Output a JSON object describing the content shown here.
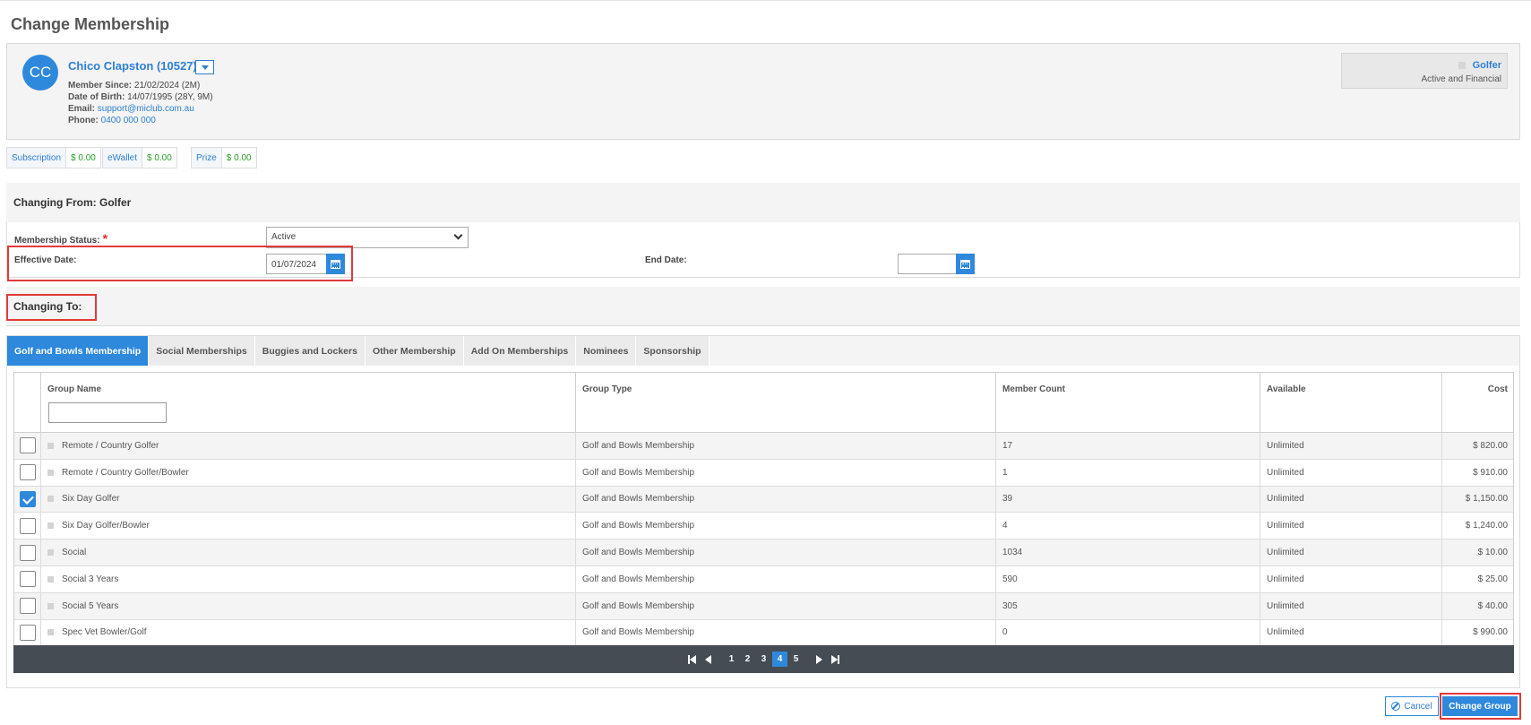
{
  "page": {
    "title": "Change Membership"
  },
  "member": {
    "initials": "CC",
    "name": "Chico Clapston (10527)",
    "member_since_label": "Member Since:",
    "member_since": "21/02/2024 (2M)",
    "dob_label": "Date of Birth:",
    "dob": "14/07/1995 (28Y, 9M)",
    "email_label": "Email:",
    "email": "support@miclub.com.au",
    "phone_label": "Phone:",
    "phone": "0400 000 000",
    "membership_type": "Golfer",
    "membership_status": "Active and Financial"
  },
  "balances": [
    {
      "label": "Subscription",
      "value": "$ 0.00"
    },
    {
      "label": "eWallet",
      "value": "$ 0.00"
    },
    {
      "label": "Prize",
      "value": "$ 0.00"
    }
  ],
  "changing_from": {
    "title": "Changing From: Golfer",
    "status_label": "Membership Status:",
    "status_value": "Active",
    "effective_label": "Effective Date:",
    "effective_value": "01/07/2024",
    "end_label": "End Date:",
    "end_value": ""
  },
  "changing_to": {
    "title": "Changing To:",
    "tabs": [
      "Golf and Bowls Membership",
      "Social Memberships",
      "Buggies and Lockers",
      "Other Membership",
      "Add On Memberships",
      "Nominees",
      "Sponsorship"
    ],
    "active_tab": 0
  },
  "grid": {
    "columns": [
      "Group Name",
      "Group Type",
      "Member Count",
      "Available",
      "Cost"
    ],
    "filter_value": "",
    "rows": [
      {
        "name": "Remote / Country Golfer",
        "type": "Golf and Bowls Membership",
        "count": "17",
        "available": "Unlimited",
        "cost": "$ 820.00",
        "checked": false
      },
      {
        "name": "Remote / Country Golfer/Bowler",
        "type": "Golf and Bowls Membership",
        "count": "1",
        "available": "Unlimited",
        "cost": "$ 910.00",
        "checked": false
      },
      {
        "name": "Six Day Golfer",
        "type": "Golf and Bowls Membership",
        "count": "39",
        "available": "Unlimited",
        "cost": "$ 1,150.00",
        "checked": true
      },
      {
        "name": "Six Day Golfer/Bowler",
        "type": "Golf and Bowls Membership",
        "count": "4",
        "available": "Unlimited",
        "cost": "$ 1,240.00",
        "checked": false
      },
      {
        "name": "Social",
        "type": "Golf and Bowls Membership",
        "count": "1034",
        "available": "Unlimited",
        "cost": "$ 10.00",
        "checked": false
      },
      {
        "name": "Social 3 Years",
        "type": "Golf and Bowls Membership",
        "count": "590",
        "available": "Unlimited",
        "cost": "$ 25.00",
        "checked": false
      },
      {
        "name": "Social 5 Years",
        "type": "Golf and Bowls Membership",
        "count": "305",
        "available": "Unlimited",
        "cost": "$ 40.00",
        "checked": false
      },
      {
        "name": "Spec Vet Bowler/Golf",
        "type": "Golf and Bowls Membership",
        "count": "0",
        "available": "Unlimited",
        "cost": "$ 990.00",
        "checked": false
      }
    ]
  },
  "pager": {
    "pages": [
      "1",
      "2",
      "3",
      "4",
      "5"
    ],
    "current": "4"
  },
  "actions": {
    "cancel": "Cancel",
    "change": "Change Group"
  },
  "colors": {
    "accent": "#2e88dc",
    "highlight": "#e03a3a",
    "money": "#2a9d2a"
  }
}
